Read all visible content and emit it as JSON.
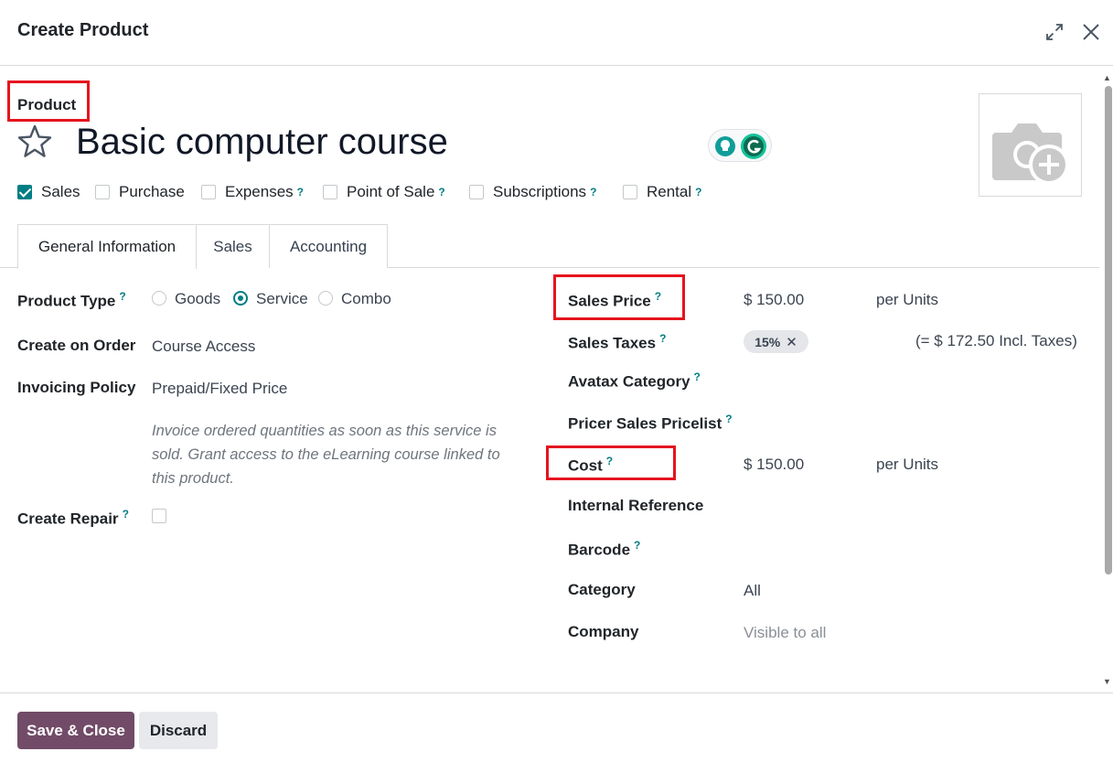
{
  "dialog": {
    "title": "Create Product"
  },
  "product": {
    "type_label": "Product",
    "name": "Basic computer course"
  },
  "flags": [
    {
      "label": "Sales",
      "checked": true,
      "help": false
    },
    {
      "label": "Purchase",
      "checked": false,
      "help": false
    },
    {
      "label": "Expenses",
      "checked": false,
      "help": true
    },
    {
      "label": "Point of Sale",
      "checked": false,
      "help": true
    },
    {
      "label": "Subscriptions",
      "checked": false,
      "help": true
    },
    {
      "label": "Rental",
      "checked": false,
      "help": true
    }
  ],
  "help_mark": "?",
  "tabs": [
    {
      "label": "General Information",
      "active": true
    },
    {
      "label": "Sales",
      "active": false
    },
    {
      "label": "Accounting",
      "active": false
    }
  ],
  "left": {
    "product_type": {
      "label": "Product Type",
      "options": [
        "Goods",
        "Service",
        "Combo"
      ],
      "selected": "Service"
    },
    "create_on_order": {
      "label": "Create on Order",
      "value": "Course Access"
    },
    "invoicing_policy": {
      "label": "Invoicing Policy",
      "value": "Prepaid/Fixed Price"
    },
    "note": "Invoice ordered quantities as soon as this service is sold. Grant access to the eLearning course linked to this product.",
    "create_repair": {
      "label": "Create Repair",
      "checked": false
    }
  },
  "right": {
    "sales_price": {
      "label": "Sales Price",
      "value": "$ 150.00",
      "unit": "per Units"
    },
    "sales_taxes": {
      "label": "Sales Taxes",
      "badge": "15%",
      "incl": "(= $ 172.50 Incl. Taxes)"
    },
    "avatax_category": {
      "label": "Avatax Category"
    },
    "pricer_pricelist": {
      "label": "Pricer Sales Pricelist"
    },
    "cost": {
      "label": "Cost",
      "value": "$ 150.00",
      "unit": "per Units"
    },
    "internal_reference": {
      "label": "Internal Reference"
    },
    "barcode": {
      "label": "Barcode"
    },
    "category": {
      "label": "Category",
      "value": "All"
    },
    "company": {
      "label": "Company",
      "placeholder": "Visible to all"
    }
  },
  "footer": {
    "save_label": "Save & Close",
    "discard_label": "Discard"
  },
  "colors": {
    "accent": "#017e84",
    "primary_button": "#714b67",
    "highlight": "#e5141e"
  }
}
